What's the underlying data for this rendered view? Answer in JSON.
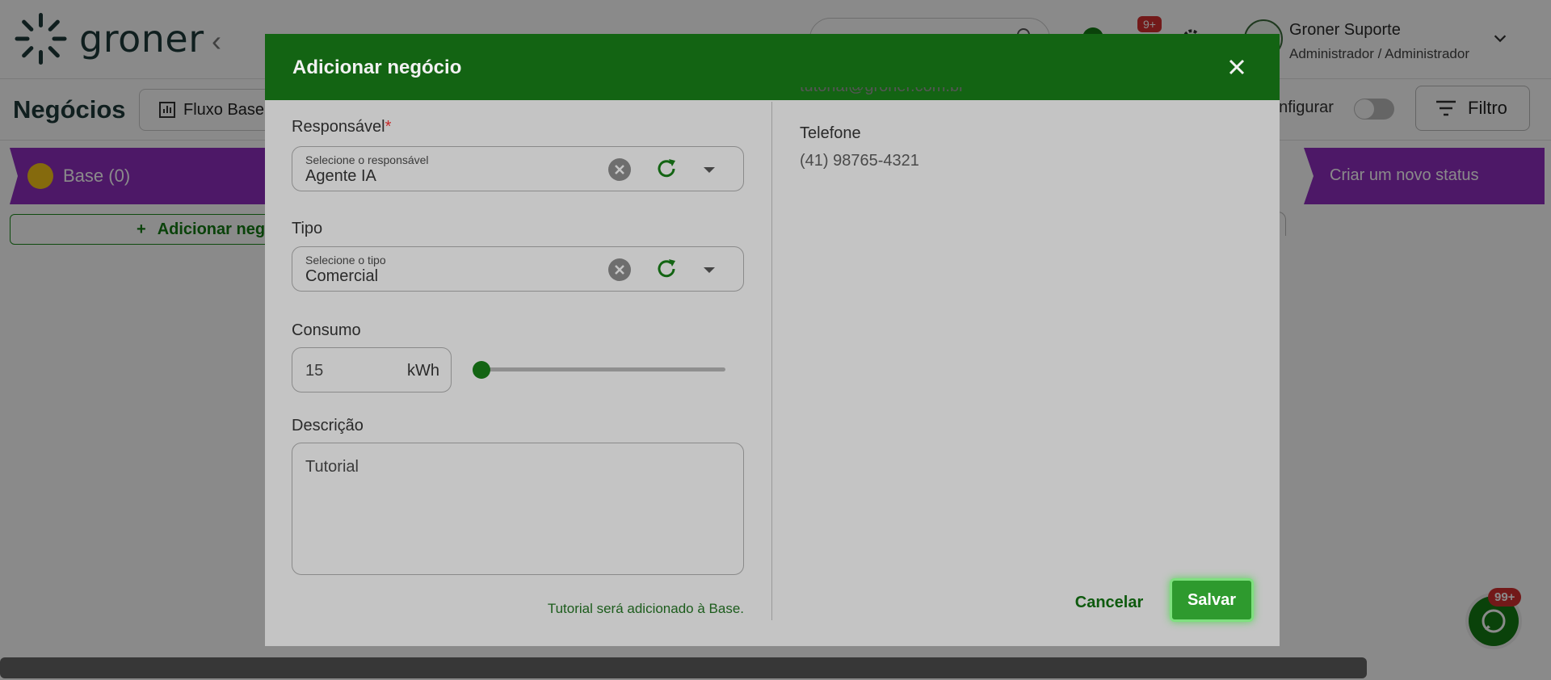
{
  "app": {
    "logo_text": "groner",
    "user": {
      "name": "Groner Suporte",
      "role": "Administrador / Administrador"
    },
    "notifications_badge": "9+",
    "page_title": "Negócios",
    "flow_select_label": "Fluxo Base",
    "configure_label": "onfigurar",
    "filter_label": "Filtro",
    "columns": [
      {
        "label": "Base (0)"
      },
      {
        "label": "Criar um novo status"
      }
    ],
    "add_business_label": "Adicionar neg",
    "whatsapp_badge": "99+"
  },
  "modal": {
    "title": "Adicionar negócio",
    "fields": {
      "responsavel": {
        "label": "Responsável",
        "required_mark": "*",
        "placeholder": "Selecione o responsável",
        "value": "Agente IA"
      },
      "tipo": {
        "label": "Tipo",
        "placeholder": "Selecione o tipo",
        "value": "Comercial"
      },
      "consumo": {
        "label": "Consumo",
        "value": "15",
        "unit": "kWh",
        "slider_fraction": 0.0
      },
      "descricao": {
        "label": "Descrição",
        "value": "Tutorial"
      }
    },
    "hint": "Tutorial será adicionado à Base.",
    "contact": {
      "email_partial": "tutorial@groner.com.br",
      "phone_label": "Telefone",
      "phone_value": "(41) 98765-4321"
    },
    "buttons": {
      "cancel": "Cancelar",
      "save": "Salvar"
    }
  },
  "colors": {
    "header_green": "#136413",
    "status_purple": "#8e2dbf",
    "save_green": "#2e9a2e",
    "required_red": "#c62828"
  }
}
